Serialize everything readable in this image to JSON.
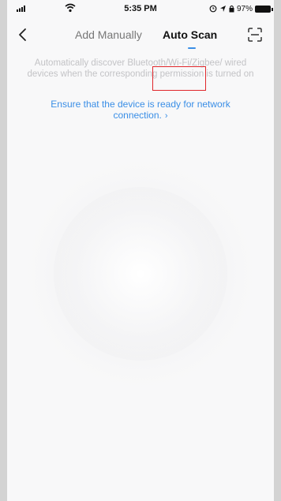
{
  "status_bar": {
    "time": "5:35 PM",
    "battery_percent": "97%",
    "icons": [
      "signal-icon",
      "wifi-icon",
      "location-icon",
      "battery-icon"
    ]
  },
  "nav": {
    "back_icon": "back-chevron-icon",
    "tabs": [
      {
        "label": "Add Manually",
        "active": false
      },
      {
        "label": "Auto Scan",
        "active": true
      }
    ],
    "scan_icon": "scan-icon"
  },
  "main": {
    "description": "Automatically discover Bluetooth/Wi-Fi/Zigbee/ wired devices when the corresponding permission is turned on",
    "hint_link": "Ensure that the device is ready for network connection.",
    "hint_icon": "chevron-right-icon"
  },
  "colors": {
    "accent": "#3a8ee6",
    "highlight": "#e0262b",
    "background": "#f8f8f9"
  }
}
